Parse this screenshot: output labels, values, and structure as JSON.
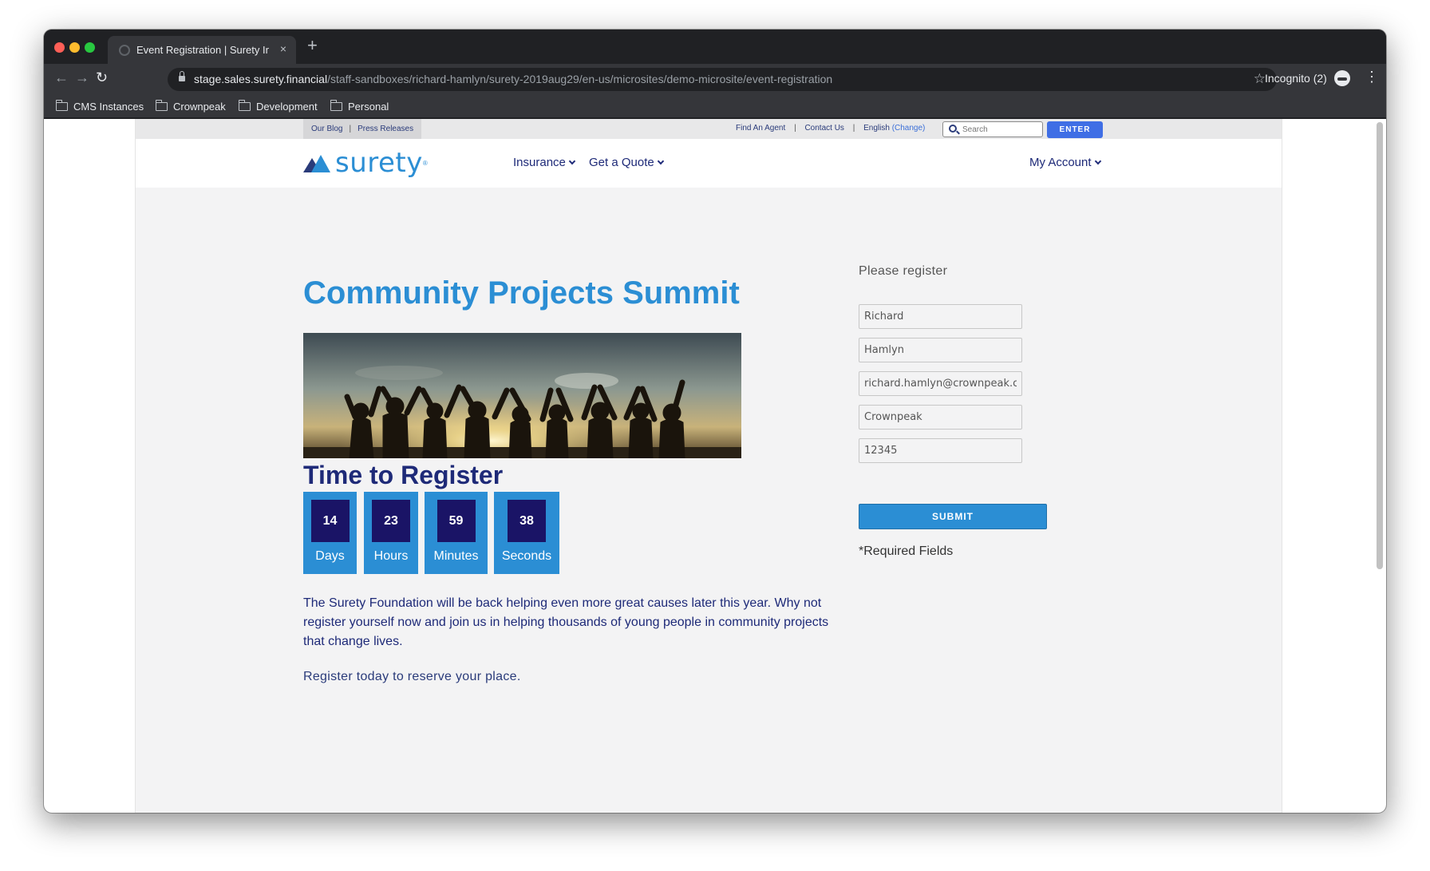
{
  "browser": {
    "tab_title": "Event Registration | Surety Insu",
    "tab_close": "×",
    "new_tab": "+",
    "url_host": "stage.sales.surety.financial",
    "url_path": "/staff-sandboxes/richard-hamlyn/surety-2019aug29/en-us/microsites/demo-microsite/event-registration",
    "incognito_label": "Incognito (2)",
    "bookmarks": [
      "CMS Instances",
      "Crownpeak",
      "Development",
      "Personal"
    ]
  },
  "site": {
    "utility_left": [
      "Our Blog",
      "Press Releases"
    ],
    "utility_right": {
      "find_agent": "Find An Agent",
      "contact": "Contact Us",
      "language": "English",
      "change": "(Change)"
    },
    "search_placeholder": "Search",
    "enter_label": "ENTER",
    "logo_text": "surety",
    "nav": {
      "insurance": "Insurance",
      "quote": "Get a Quote",
      "account": "My Account"
    },
    "colors": {
      "accent": "#2b8ed4",
      "navy": "#1e2a78",
      "countdown_tile": "#1a1466",
      "enter_button": "#3f6ee5"
    }
  },
  "event": {
    "title": "Community Projects Summit",
    "time_to_register": "Time to Register",
    "countdown": [
      {
        "value": "14",
        "label": "Days"
      },
      {
        "value": "23",
        "label": "Hours"
      },
      {
        "value": "59",
        "label": "Minutes"
      },
      {
        "value": "38",
        "label": "Seconds"
      }
    ],
    "description": "The Surety Foundation will be back helping even more great causes later this year.  Why not register yourself now and join us in helping thousands of young people in community projects that change lives.",
    "cta": "Register today to reserve your place."
  },
  "form": {
    "heading": "Please register",
    "fields": [
      "Richard",
      "Hamlyn",
      "richard.hamlyn@crownpeak.co",
      "Crownpeak",
      "12345"
    ],
    "submit_label": "SUBMIT",
    "required_note": "*Required Fields"
  }
}
